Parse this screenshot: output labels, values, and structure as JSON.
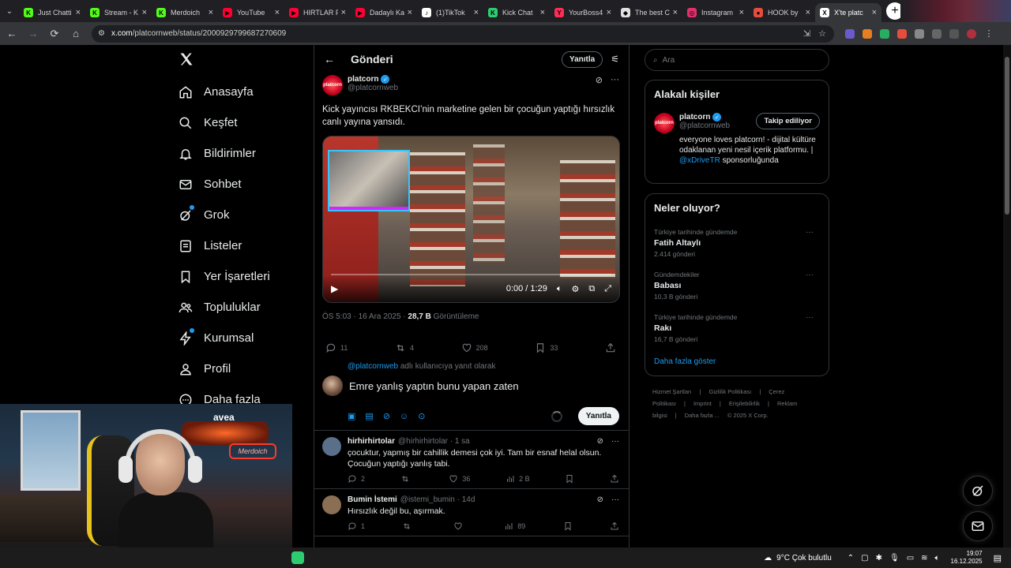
{
  "browser": {
    "tabs": [
      {
        "title": "Just Chatti",
        "color": "#53fc18",
        "glyph": "K"
      },
      {
        "title": "Stream - K",
        "color": "#53fc18",
        "glyph": "K"
      },
      {
        "title": "Merdoich",
        "color": "#53fc18",
        "glyph": "K"
      },
      {
        "title": "YouTube",
        "color": "#ff0033",
        "glyph": "▶"
      },
      {
        "title": "HIRTLAR F",
        "color": "#ff0033",
        "glyph": "▶"
      },
      {
        "title": "Dadaylı Ka",
        "color": "#ff0033",
        "glyph": "▶"
      },
      {
        "title": "(1)TikTok",
        "color": "#ffffff",
        "glyph": "♪"
      },
      {
        "title": "Kick Chat",
        "color": "#2ecc71",
        "glyph": "K"
      },
      {
        "title": "YourBoss4",
        "color": "#ff2d55",
        "glyph": "Y"
      },
      {
        "title": "The best C",
        "color": "#e0e0e0",
        "glyph": "◆"
      },
      {
        "title": "Instagram",
        "color": "#e1306c",
        "glyph": "◎"
      },
      {
        "title": "HOOK by",
        "color": "#e74c3c",
        "glyph": "●"
      },
      {
        "title": "X'te platc",
        "color": "#ffffff",
        "glyph": "X",
        "active": true
      }
    ],
    "url": {
      "host": "x.com",
      "path": "/platcornweb/status/2000929799687270609"
    }
  },
  "nav": {
    "items": [
      {
        "label": "Anasayfa",
        "icon": "home-icon"
      },
      {
        "label": "Keşfet",
        "icon": "search-icon"
      },
      {
        "label": "Bildirimler",
        "icon": "bell-icon"
      },
      {
        "label": "Sohbet",
        "icon": "mail-icon"
      },
      {
        "label": "Grok",
        "icon": "grok-icon"
      },
      {
        "label": "Listeler",
        "icon": "list-icon"
      },
      {
        "label": "Yer İşaretleri",
        "icon": "bookmark-icon"
      },
      {
        "label": "Topluluklar",
        "icon": "people-icon"
      },
      {
        "label": "Kurumsal",
        "icon": "bolt-icon"
      },
      {
        "label": "Profil",
        "icon": "person-icon"
      },
      {
        "label": "Daha fazla",
        "icon": "more-icon"
      }
    ]
  },
  "header": {
    "title": "Gönderi",
    "reply_pill": "Yanıtla"
  },
  "post": {
    "author": "platcorn",
    "handle": "@platcornweb",
    "avatar_text": "platcorn",
    "text": "Kick yayıncısı RKBEKCI’nin marketine gelen bir çocuğun yaptığı hırsızlık canlı yayına yansıdı.",
    "video_time": "0:00 / 1:29",
    "video_progress": 0,
    "meta_time": "ÖS 5:03 · 16 Ara 2025 · ",
    "views": "28,7 B",
    "views_label": " Görüntüleme",
    "stats": {
      "replies": "11",
      "reposts": "4",
      "likes": "208",
      "bookmarks": "33"
    }
  },
  "compose": {
    "replying_prefix": "@platcornweb",
    "replying_suffix": " adlı kullanıcıya yanıt olarak",
    "value": "Emre yanlış yaptın bunu yapan zaten",
    "reply_button": "Yanıtla"
  },
  "comments": [
    {
      "name": "hirhirhirtolar",
      "handle": "@hirhirhirtolar · 1 sa",
      "text": "çocuktur, yapmış bir cahillik demesi çok iyi. Tam bir esnaf helal olsun. Çocuğun yaptığı yanlış tabi.",
      "replies": "2",
      "reposts": "",
      "likes": "36",
      "views": "2 B",
      "avatar_color": "#5a6f8a"
    },
    {
      "name": "Bumin İstemi",
      "handle": "@istemi_bumin · 14d",
      "text": "Hırsızlık değil bu, aşırmak.",
      "replies": "1",
      "reposts": "",
      "likes": "",
      "views": "89",
      "avatar_color": "#8a6f55"
    }
  ],
  "right": {
    "search_placeholder": "Ara",
    "related": {
      "title": "Alakalı kişiler",
      "name": "platcorn",
      "handle": "@platcornweb",
      "follow_label": "Takip ediliyor",
      "bio_1": "everyone loves platcorn! - dijital kültüre odaklanan yeni nesil içerik platformu. | ",
      "bio_link": "@xDriveTR",
      "bio_2": " sponsorluğunda"
    },
    "trends": {
      "title": "Neler oluyor?",
      "items": [
        {
          "category": "Türkiye tarihinde gündemde",
          "name": "Fatih Altaylı",
          "count": "2.414 gönderi"
        },
        {
          "category": "Gündemdekiler",
          "name": "Babası",
          "count": "10,3 B gönderi"
        },
        {
          "category": "Türkiye tarihinde gündemde",
          "name": "Rakı",
          "count": "16,7 B gönderi"
        }
      ],
      "show_more": "Daha fazla göster"
    },
    "footer": [
      "Hizmet Şartları",
      "|",
      "Gizlilik Politikası",
      "|",
      "Çerez Politikası",
      "|",
      "Imprint",
      "|",
      "Erişilebilirlik",
      "|",
      "Reklam bilgisi",
      "|",
      "Daha fazla ...",
      "© 2025 X Corp."
    ]
  },
  "webcam": {
    "brand": "avea",
    "neon": "Merdoich"
  },
  "taskbar": {
    "weather": "9°C  Çok bulutlu",
    "time": "19:07",
    "date": "16.12.2025"
  }
}
